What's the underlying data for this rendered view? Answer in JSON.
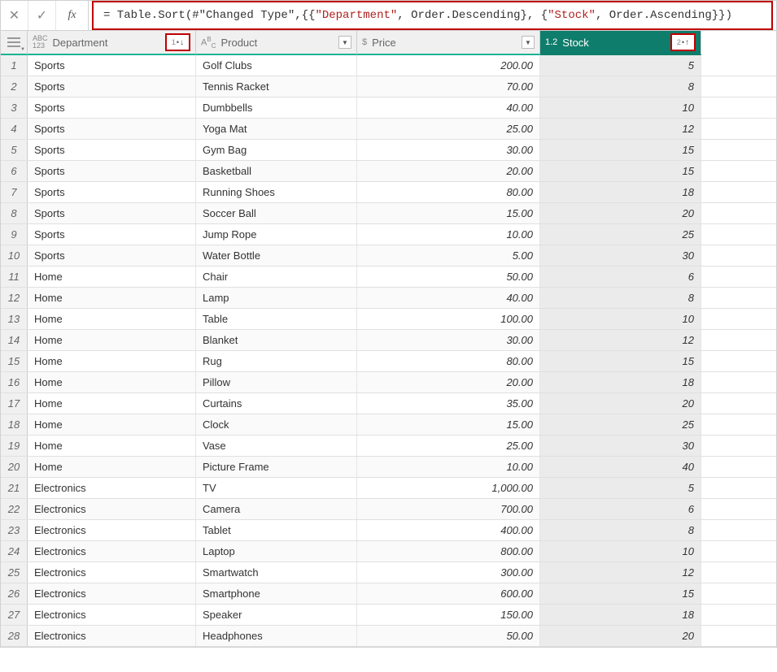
{
  "formula_bar": {
    "cancel_glyph": "✕",
    "confirm_glyph": "✓",
    "fx_label": "fx",
    "formula_parts": [
      {
        "t": "= Table.Sort(#\"Changed Type\",{{",
        "cls": "f-plain"
      },
      {
        "t": "\"Department\"",
        "cls": "f-red"
      },
      {
        "t": ", Order.Descending}, {",
        "cls": "f-plain"
      },
      {
        "t": "\"Stock\"",
        "cls": "f-red"
      },
      {
        "t": ", Order.Ascending}})",
        "cls": "f-plain"
      }
    ]
  },
  "columns": [
    {
      "key": "department",
      "label": "Department",
      "type_icon": "ABC123",
      "width": "col-dept",
      "sort": "1↓",
      "sort_highlight": true,
      "dropdown": false,
      "selected": false
    },
    {
      "key": "product",
      "label": "Product",
      "type_icon": "ABC",
      "width": "col-prod",
      "sort": null,
      "dropdown": true,
      "selected": false
    },
    {
      "key": "price",
      "label": "Price",
      "type_icon": "$",
      "width": "col-price",
      "sort": null,
      "dropdown": true,
      "selected": false
    },
    {
      "key": "stock",
      "label": "Stock",
      "type_icon": "1.2",
      "width": "col-stock",
      "sort": "2↑",
      "sort_highlight": true,
      "dropdown": false,
      "selected": true
    }
  ],
  "rows": [
    {
      "n": 1,
      "department": "Sports",
      "product": "Golf Clubs",
      "price": "200.00",
      "stock": "5"
    },
    {
      "n": 2,
      "department": "Sports",
      "product": "Tennis Racket",
      "price": "70.00",
      "stock": "8"
    },
    {
      "n": 3,
      "department": "Sports",
      "product": "Dumbbells",
      "price": "40.00",
      "stock": "10"
    },
    {
      "n": 4,
      "department": "Sports",
      "product": "Yoga Mat",
      "price": "25.00",
      "stock": "12"
    },
    {
      "n": 5,
      "department": "Sports",
      "product": "Gym Bag",
      "price": "30.00",
      "stock": "15"
    },
    {
      "n": 6,
      "department": "Sports",
      "product": "Basketball",
      "price": "20.00",
      "stock": "15"
    },
    {
      "n": 7,
      "department": "Sports",
      "product": "Running Shoes",
      "price": "80.00",
      "stock": "18"
    },
    {
      "n": 8,
      "department": "Sports",
      "product": "Soccer Ball",
      "price": "15.00",
      "stock": "20"
    },
    {
      "n": 9,
      "department": "Sports",
      "product": "Jump Rope",
      "price": "10.00",
      "stock": "25"
    },
    {
      "n": 10,
      "department": "Sports",
      "product": "Water Bottle",
      "price": "5.00",
      "stock": "30"
    },
    {
      "n": 11,
      "department": "Home",
      "product": "Chair",
      "price": "50.00",
      "stock": "6"
    },
    {
      "n": 12,
      "department": "Home",
      "product": "Lamp",
      "price": "40.00",
      "stock": "8"
    },
    {
      "n": 13,
      "department": "Home",
      "product": "Table",
      "price": "100.00",
      "stock": "10"
    },
    {
      "n": 14,
      "department": "Home",
      "product": "Blanket",
      "price": "30.00",
      "stock": "12"
    },
    {
      "n": 15,
      "department": "Home",
      "product": "Rug",
      "price": "80.00",
      "stock": "15"
    },
    {
      "n": 16,
      "department": "Home",
      "product": "Pillow",
      "price": "20.00",
      "stock": "18"
    },
    {
      "n": 17,
      "department": "Home",
      "product": "Curtains",
      "price": "35.00",
      "stock": "20"
    },
    {
      "n": 18,
      "department": "Home",
      "product": "Clock",
      "price": "15.00",
      "stock": "25"
    },
    {
      "n": 19,
      "department": "Home",
      "product": "Vase",
      "price": "25.00",
      "stock": "30"
    },
    {
      "n": 20,
      "department": "Home",
      "product": "Picture Frame",
      "price": "10.00",
      "stock": "40"
    },
    {
      "n": 21,
      "department": "Electronics",
      "product": "TV",
      "price": "1,000.00",
      "stock": "5"
    },
    {
      "n": 22,
      "department": "Electronics",
      "product": "Camera",
      "price": "700.00",
      "stock": "6"
    },
    {
      "n": 23,
      "department": "Electronics",
      "product": "Tablet",
      "price": "400.00",
      "stock": "8"
    },
    {
      "n": 24,
      "department": "Electronics",
      "product": "Laptop",
      "price": "800.00",
      "stock": "10"
    },
    {
      "n": 25,
      "department": "Electronics",
      "product": "Smartwatch",
      "price": "300.00",
      "stock": "12"
    },
    {
      "n": 26,
      "department": "Electronics",
      "product": "Smartphone",
      "price": "600.00",
      "stock": "15"
    },
    {
      "n": 27,
      "department": "Electronics",
      "product": "Speaker",
      "price": "150.00",
      "stock": "18"
    },
    {
      "n": 28,
      "department": "Electronics",
      "product": "Headphones",
      "price": "50.00",
      "stock": "20"
    }
  ]
}
